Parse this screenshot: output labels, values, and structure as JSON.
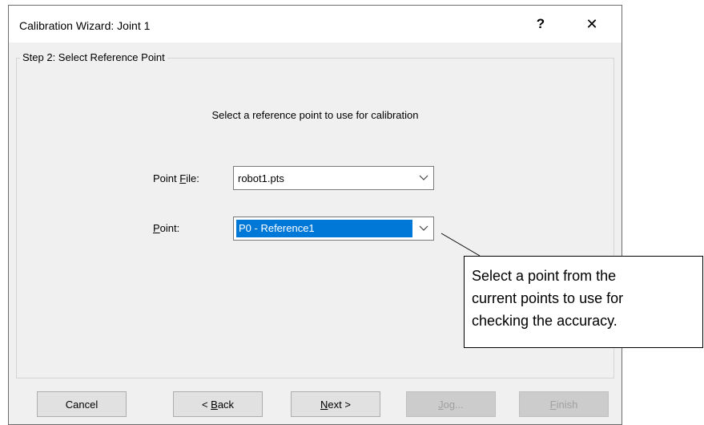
{
  "window": {
    "title": "Calibration Wizard: Joint 1",
    "help_glyph": "?",
    "close_glyph": "✕"
  },
  "step": {
    "legend": "Step 2: Select Reference Point",
    "instruction": "Select a reference point to use for calibration",
    "point_file": {
      "label_before": "Point ",
      "label_mnemonic": "F",
      "label_after": "ile:",
      "value": "robot1.pts"
    },
    "point": {
      "label_mnemonic": "P",
      "label_after": "oint:",
      "value": "P0 - Reference1"
    }
  },
  "buttons": {
    "cancel": "Cancel",
    "back_prefix": "< ",
    "back_mnemonic": "B",
    "back_rest": "ack",
    "next_mnemonic": "N",
    "next_rest": "ext >",
    "jog_mnemonic": "J",
    "jog_rest": "og...",
    "finish_mnemonic": "F",
    "finish_rest": "inish"
  },
  "callout": {
    "line1": "Select a point from the",
    "line2": "current points to use for",
    "line3": "checking the accuracy."
  },
  "icons": {
    "dropdown": "chevron-down-icon",
    "help": "help-icon",
    "close": "close-icon"
  },
  "colors": {
    "selection": "#0078d7",
    "dialog_bg": "#f0f0f0",
    "disabled_text": "#a0a0a0"
  }
}
